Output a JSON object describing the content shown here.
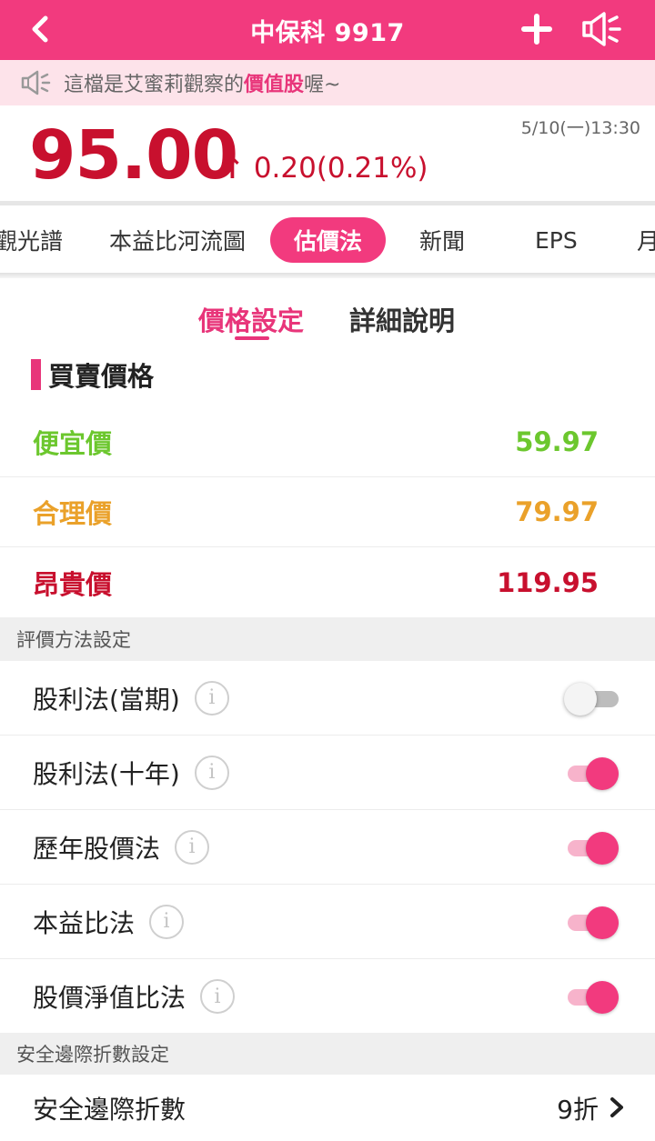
{
  "header": {
    "title": "中保科 9917"
  },
  "notice": {
    "prefix": "這檔是艾蜜莉觀察的",
    "highlight": "價值股",
    "suffix": "喔~"
  },
  "quote": {
    "price": "95.00",
    "change": "0.20(0.21%)",
    "timestamp": "5/10(一)13:30",
    "color_up": "#c8102e"
  },
  "tabs": [
    {
      "label": "觀光譜"
    },
    {
      "label": "本益比河流圖"
    },
    {
      "label": "估價法"
    },
    {
      "label": "新聞"
    },
    {
      "label": "EPS"
    },
    {
      "label": "月"
    }
  ],
  "subtabs": [
    {
      "label": "價格設定"
    },
    {
      "label": "詳細說明"
    }
  ],
  "price_section": {
    "title": "買賣價格",
    "rows": [
      {
        "label": "便宜價",
        "value": "59.97",
        "color": "#6cc72e"
      },
      {
        "label": "合理價",
        "value": "79.97",
        "color": "#eaa12a"
      },
      {
        "label": "昂貴價",
        "value": "119.95",
        "color": "#c8102e"
      }
    ]
  },
  "method_section": {
    "title": "評價方法設定",
    "items": [
      {
        "label": "股利法(當期)",
        "enabled": false
      },
      {
        "label": "股利法(十年)",
        "enabled": true
      },
      {
        "label": "歷年股價法",
        "enabled": true
      },
      {
        "label": "本益比法",
        "enabled": true
      },
      {
        "label": "股價淨值比法",
        "enabled": true
      }
    ]
  },
  "safety_section": {
    "title": "安全邊際折數設定",
    "label": "安全邊際折數",
    "value": "9折"
  },
  "accent_color": "#f23a7e"
}
